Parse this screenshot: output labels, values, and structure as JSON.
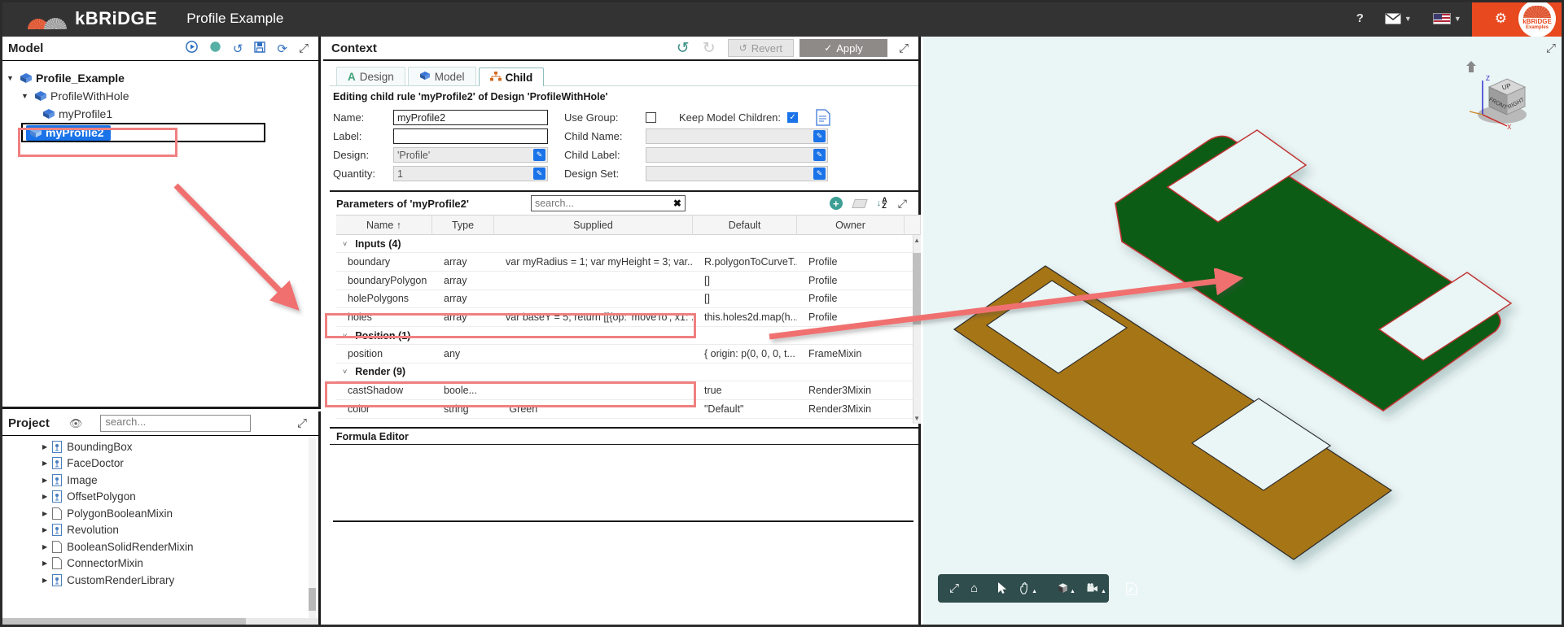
{
  "topbar": {
    "brand": "kBRiDGE",
    "title": "Profile Example",
    "help_icon": "?",
    "mail_icon": "mail-icon",
    "flag_icon": "us-flag-icon",
    "gear_icon": "gear-icon",
    "badge_line1": "kBRiDGE",
    "badge_line2": "Examples",
    "accent_color": "#e8491f",
    "bg_color": "#333333"
  },
  "model_panel": {
    "title": "Model",
    "tools": [
      {
        "name": "run-icon",
        "glyph": "▶"
      },
      {
        "name": "status-dot-icon",
        "glyph": "●"
      },
      {
        "name": "history-icon",
        "glyph": "↺"
      },
      {
        "name": "save-icon",
        "glyph": "💾"
      },
      {
        "name": "refresh-icon",
        "glyph": "⟳"
      },
      {
        "name": "expand-icon",
        "glyph": "⤢"
      }
    ],
    "tree": [
      {
        "label": "Profile_Example",
        "depth": 0,
        "expanded": true,
        "bold": true
      },
      {
        "label": "ProfileWithHole",
        "depth": 1,
        "expanded": true,
        "bold": false
      },
      {
        "label": "myProfile1",
        "depth": 2,
        "expanded": false,
        "bold": false
      },
      {
        "label": "myProfile2",
        "depth": 2,
        "expanded": false,
        "bold": false,
        "selected": true
      }
    ]
  },
  "project_panel": {
    "title": "Project",
    "search_placeholder": "search...",
    "eye_icon": "eye-slash-icon",
    "expand_icon": "expand-icon",
    "items": [
      {
        "label": "BoundingBox",
        "type": "script"
      },
      {
        "label": "FaceDoctor",
        "type": "script"
      },
      {
        "label": "Image",
        "type": "script"
      },
      {
        "label": "OffsetPolygon",
        "type": "script"
      },
      {
        "label": "PolygonBooleanMixin",
        "type": "plain"
      },
      {
        "label": "Revolution",
        "type": "script"
      },
      {
        "label": "BooleanSolidRenderMixin",
        "type": "plain"
      },
      {
        "label": "ConnectorMixin",
        "type": "plain"
      },
      {
        "label": "CustomRenderLibrary",
        "type": "script"
      }
    ]
  },
  "context": {
    "title": "Context",
    "undo_icon": "undo-icon",
    "redo_icon": "redo-icon",
    "revert_label": "Revert",
    "apply_label": "Apply",
    "expand_icon": "expand-icon",
    "tabs": [
      {
        "label": "Design",
        "icon": "design-a-icon",
        "active": false
      },
      {
        "label": "Model",
        "icon": "model-cube-icon",
        "active": false
      },
      {
        "label": "Child",
        "icon": "child-hierarchy-icon",
        "active": true
      }
    ],
    "subtitle": "Editing child rule 'myProfile2' of Design 'ProfileWithHole'",
    "form": {
      "left": [
        {
          "label": "Name:",
          "value": "myProfile2",
          "readonly": false,
          "pen": false
        },
        {
          "label": "Label:",
          "value": "",
          "readonly": false,
          "pen": false
        },
        {
          "label": "Design:",
          "value": "'Profile'",
          "readonly": true,
          "pen": true
        },
        {
          "label": "Quantity:",
          "value": "1",
          "readonly": true,
          "pen": true
        }
      ],
      "use_group_label": "Use Group:",
      "use_group_checked": false,
      "keep_model_children_label": "Keep Model Children:",
      "keep_model_children_checked": true,
      "doc_icon": "document-icon",
      "right": [
        {
          "label": "Child Name:",
          "value": "",
          "pen": true
        },
        {
          "label": "Child Label:",
          "value": "",
          "pen": true
        },
        {
          "label": "Design Set:",
          "value": "",
          "pen": true
        }
      ]
    }
  },
  "parameters": {
    "title": "Parameters of 'myProfile2'",
    "search_placeholder": "search...",
    "clear_icon": "clear-x-icon",
    "add_icon": "add-circle-icon",
    "eraser_icon": "eraser-icon",
    "sort_icon": "sort-az-icon",
    "expand_icon": "expand-icon",
    "columns": [
      "Name ↑",
      "Type",
      "Supplied",
      "Default",
      "Owner"
    ],
    "groups": [
      {
        "label": "Inputs (4)",
        "rows": [
          {
            "name": "boundary",
            "type": "array",
            "supplied": "var myRadius = 1; var myHeight = 3; var...",
            "default": "R.polygonToCurveT...",
            "owner": "Profile",
            "highlight": true
          },
          {
            "name": "boundaryPolygon",
            "type": "array",
            "supplied": "",
            "default": "[]",
            "owner": "Profile",
            "highlight": false
          },
          {
            "name": "holePolygons",
            "type": "array",
            "supplied": "",
            "default": "[]",
            "owner": "Profile",
            "highlight": false
          },
          {
            "name": "holes",
            "type": "array",
            "supplied": "var baseY = 5; return [[{op: 'moveTo', x1: ...",
            "default": "this.holes2d.map(h...",
            "owner": "Profile",
            "highlight": true
          }
        ]
      },
      {
        "label": "Position (1)",
        "rows": [
          {
            "name": "position",
            "type": "any",
            "supplied": "",
            "default": "{ origin: p(0, 0, 0, t...",
            "owner": "FrameMixin",
            "highlight": false
          }
        ]
      },
      {
        "label": "Render (9)",
        "rows": [
          {
            "name": "castShadow",
            "type": "boole...",
            "supplied": "",
            "default": "true",
            "owner": "Render3Mixin",
            "highlight": false
          },
          {
            "name": "color",
            "type": "string",
            "supplied": "\"Green\"",
            "default": "\"Default\"",
            "owner": "Render3Mixin",
            "highlight": false
          }
        ]
      }
    ]
  },
  "formula_editor": {
    "title": "Formula Editor",
    "content": ""
  },
  "viewport": {
    "background_color": "#eaf5f5",
    "expand_icon": "expand-icon",
    "navcube": {
      "home_icon": "home-icon",
      "face_top": "UP",
      "face_front": "FRONT",
      "face_right": "RIGHT",
      "axis_z": "Z",
      "axis_x": "X"
    },
    "toolbar": [
      {
        "name": "fit-view-icon",
        "glyph": "⤢",
        "caret": false
      },
      {
        "name": "home-view-icon",
        "glyph": "⌂",
        "caret": false
      },
      {
        "name": "separator",
        "glyph": "",
        "caret": false
      },
      {
        "name": "select-cursor-icon",
        "glyph": "➤",
        "caret": false
      },
      {
        "name": "pan-hand-icon",
        "glyph": "✋",
        "caret": true
      },
      {
        "name": "separator",
        "glyph": "",
        "caret": false
      },
      {
        "name": "shading-cube-icon",
        "glyph": "■",
        "caret": true
      },
      {
        "name": "camera-icon",
        "glyph": "🎥",
        "caret": true
      },
      {
        "name": "separator",
        "glyph": "",
        "caret": false
      },
      {
        "name": "export-pdf-icon",
        "glyph": "Ὄ4",
        "caret": false
      }
    ],
    "shapes": [
      {
        "name": "green-plate",
        "color": "#0a5c16",
        "edge": "#c03030",
        "holes": 2,
        "corners": "rounded"
      },
      {
        "name": "brown-plate",
        "color": "#a67419",
        "edge": "#2b2b2b",
        "holes": 2,
        "corners": "sharp"
      }
    ]
  },
  "annotations": {
    "color": "#f08080",
    "rects": [
      "tree-myprofile2",
      "row-boundary",
      "row-holes"
    ],
    "arrows": [
      "tree-to-table",
      "table-to-viewport"
    ]
  }
}
